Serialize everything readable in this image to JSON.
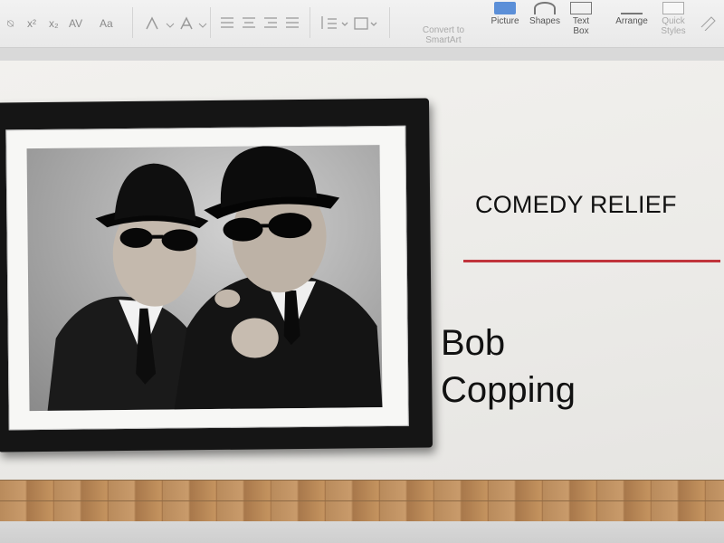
{
  "ribbon": {
    "format_controls": [
      "⍉",
      "x²",
      "x₂",
      "AV",
      "Aa"
    ],
    "insert_buttons": [
      {
        "id": "smartart",
        "label": "Convert to SmartArt",
        "line1": "Convert to",
        "line2": "SmartArt",
        "icon": "smartart-icon",
        "enabled": false
      },
      {
        "id": "picture",
        "label": "Picture",
        "icon": "picture-icon",
        "enabled": true
      },
      {
        "id": "shapes",
        "label": "Shapes",
        "icon": "shapes-icon",
        "enabled": true
      },
      {
        "id": "textbox",
        "label": "Text Box",
        "line1": "Text",
        "line2": "Box",
        "icon": "textbox-icon",
        "enabled": true
      },
      {
        "id": "arrange",
        "label": "Arrange",
        "icon": "arrange-icon",
        "enabled": true
      },
      {
        "id": "quickstyles",
        "label": "Quick Styles",
        "line1": "Quick",
        "line2": "Styles",
        "icon": "quick-styles-icon",
        "enabled": false
      }
    ]
  },
  "slide": {
    "title": "COMEDY RELIEF",
    "name": "Bob Copping",
    "name_line1": "Bob",
    "name_line2": "Copping",
    "accent_color": "#c0343c"
  }
}
